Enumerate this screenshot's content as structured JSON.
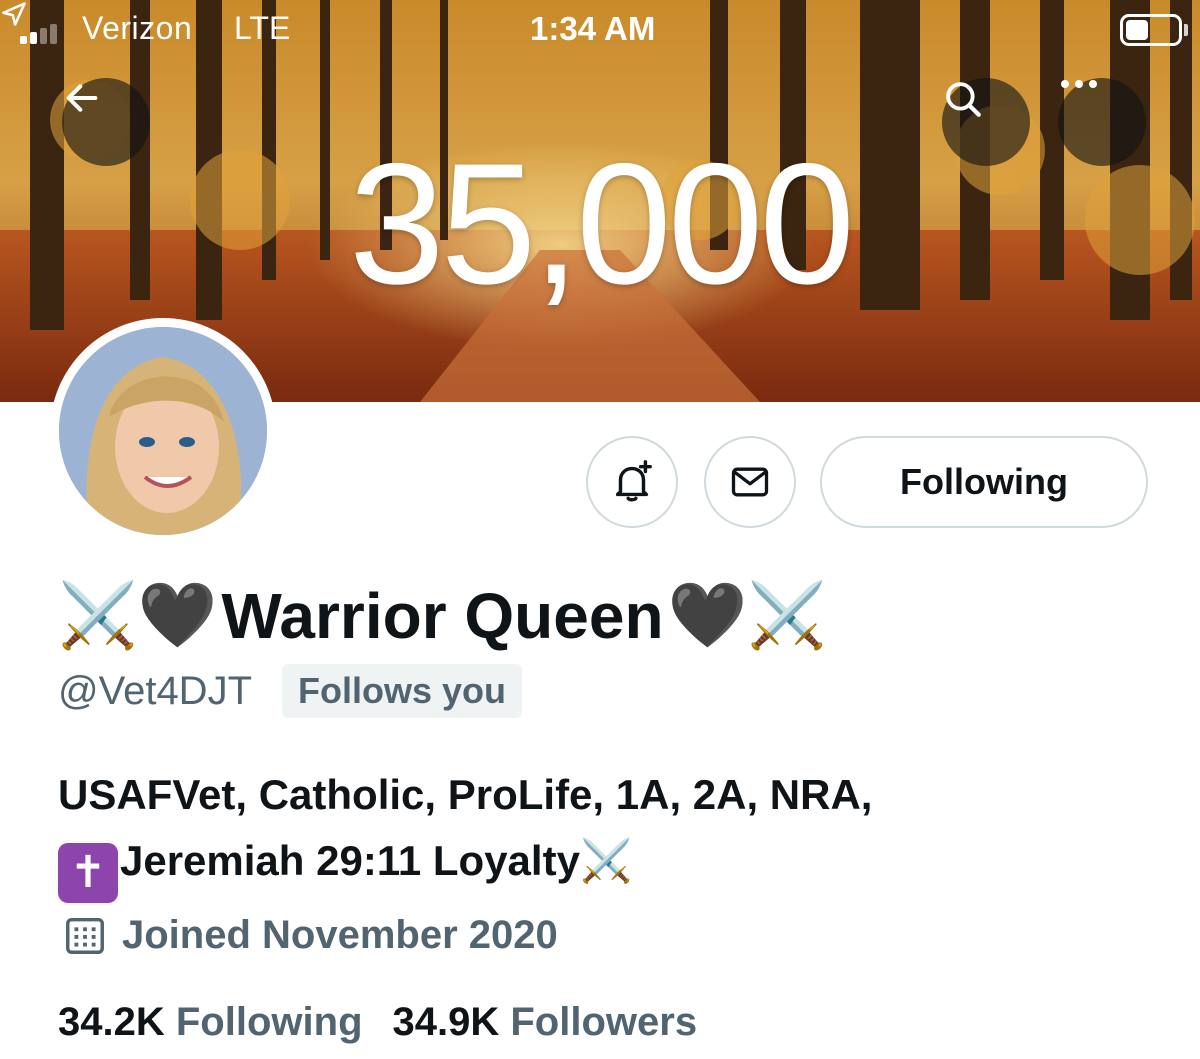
{
  "status_bar": {
    "carrier": "Verizon",
    "network": "LTE",
    "time": "1:34 AM"
  },
  "header": {
    "banner_text": "35,000",
    "back_icon": "back-arrow-icon",
    "search_icon": "search-icon",
    "more_icon": "more-icon"
  },
  "profile": {
    "display_name": "Warrior Queen",
    "name_prefix_emoji": "⚔️🖤",
    "name_suffix_emoji": "🖤⚔️",
    "handle": "@Vet4DJT",
    "follows_you_badge": "Follows you",
    "bio_line1": "USAFVet, Catholic, ProLife, 1A, 2A, NRA,",
    "bio_cross": "✝",
    "bio_line2": "Jeremiah 29:11 Loyalty",
    "bio_line2_suffix": "⚔️",
    "joined": "Joined November 2020",
    "following_count": "34.2K",
    "following_label": "Following",
    "followers_count": "34.9K",
    "followers_label": "Followers"
  },
  "actions": {
    "notify_icon": "bell-plus-icon",
    "message_icon": "envelope-icon",
    "following_button": "Following"
  }
}
